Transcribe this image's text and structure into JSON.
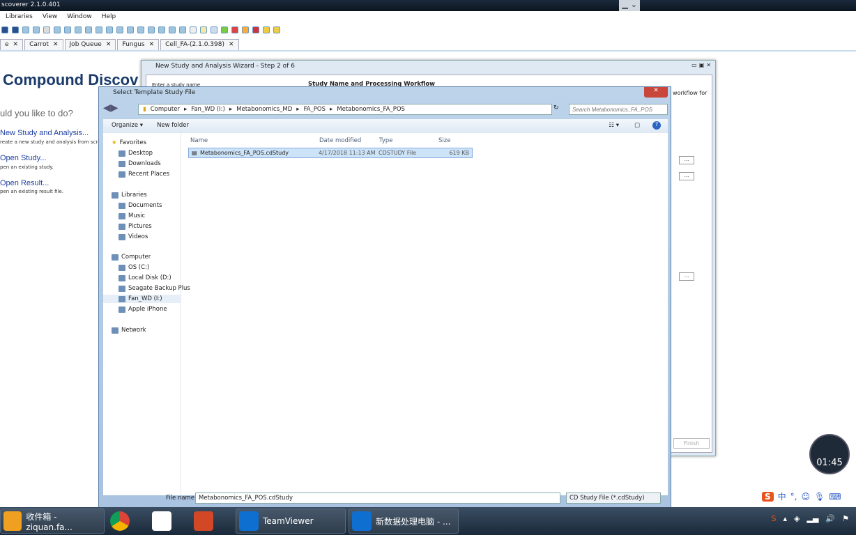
{
  "app": {
    "title": "scoverer 2.1.0.401",
    "menu": [
      "Libraries",
      "View",
      "Window",
      "Help"
    ],
    "tabs": [
      "e",
      "Carrot",
      "Job Queue",
      "Fungus",
      "Cell_FA-(2.1.0.398)"
    ]
  },
  "start": {
    "title": "Compound Discov",
    "question": "uld you like to do?",
    "links": [
      {
        "label": "New Study and Analysis...",
        "desc": "reate a new study and analysis from scratch."
      },
      {
        "label": "Open Study...",
        "desc": "pen an existing study."
      },
      {
        "label": "Open Result...",
        "desc": "pen an existing result file."
      }
    ]
  },
  "wizard": {
    "title": "New Study and Analysis Wizard - Step 2 of 6",
    "left_label": "Enter a study name",
    "heading": "Study Name and Processing Workflow",
    "right_text": "workflow for",
    "finish": "Finish",
    "browse": "..."
  },
  "dialog": {
    "title": "Select Template Study File",
    "path": [
      "Computer",
      "Fan_WD (I:)",
      "Metabonomics_MD",
      "FA_POS",
      "Metabonomics_FA_POS"
    ],
    "search_placeholder": "Search Metabonomics_FA_POS",
    "organize": "Organize ▾",
    "new_folder": "New folder",
    "nav": {
      "favorites": "Favorites",
      "fav_items": [
        "Desktop",
        "Downloads",
        "Recent Places"
      ],
      "libraries": "Libraries",
      "lib_items": [
        "Documents",
        "Music",
        "Pictures",
        "Videos"
      ],
      "computer": "Computer",
      "comp_items": [
        "OS (C:)",
        "Local Disk (D:)",
        "Seagate Backup Plus",
        "Fan_WD (I:)",
        "Apple iPhone"
      ],
      "network": "Network"
    },
    "columns": [
      "Name",
      "Date modified",
      "Type",
      "Size"
    ],
    "files": [
      {
        "name": "Metabonomics_FA_POS.cdStudy",
        "date": "4/17/2018 11:13 AM",
        "type": "CDSTUDY File",
        "size": "619 KB"
      }
    ],
    "file_name_label": "File name:",
    "file_name": "Metabonomics_FA_POS.cdStudy",
    "file_type": "CD Study File (*.cdStudy)"
  },
  "taskbar": {
    "items": [
      "收件箱 - ziquan.fa...",
      "",
      "",
      "",
      "TeamViewer",
      "新数据处理电脑 - ..."
    ]
  },
  "overlay": {
    "timer": "01:45",
    "ime": "中"
  }
}
